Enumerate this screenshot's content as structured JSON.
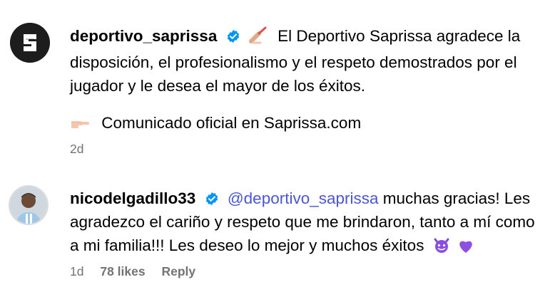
{
  "comments": [
    {
      "username": "deportivo_saprissa",
      "verified": true,
      "avatar_icon": "saprissa-s-logo",
      "text_lead_emoji": "writing-hand-icon",
      "text": "El Deportivo Saprissa agradece la disposición, el profesionalismo y el respeto demostrados por el jugador y le desea el mayor de los éxitos.",
      "second_emoji": "pointing-hand-icon",
      "second_text": "Comunicado oficial en Saprissa.com",
      "time": "2d"
    },
    {
      "username": "nicodelgadillo33",
      "verified": true,
      "avatar_icon": "profile-photo",
      "mention": "@deportivo_saprissa",
      "text": "muchas gracias! Les agradezco el cariño y respeto que me brindaron, tanto a mí como a mi familia!!! Les deseo lo mejor y muchos éxitos",
      "trailing_emojis": [
        "smiling-devil-icon",
        "purple-heart-icon"
      ],
      "time": "1d",
      "likes": "78 likes",
      "reply": "Reply"
    }
  ],
  "colors": {
    "link": "#4a56d6",
    "muted": "#737373",
    "verified": "#0095f6"
  }
}
